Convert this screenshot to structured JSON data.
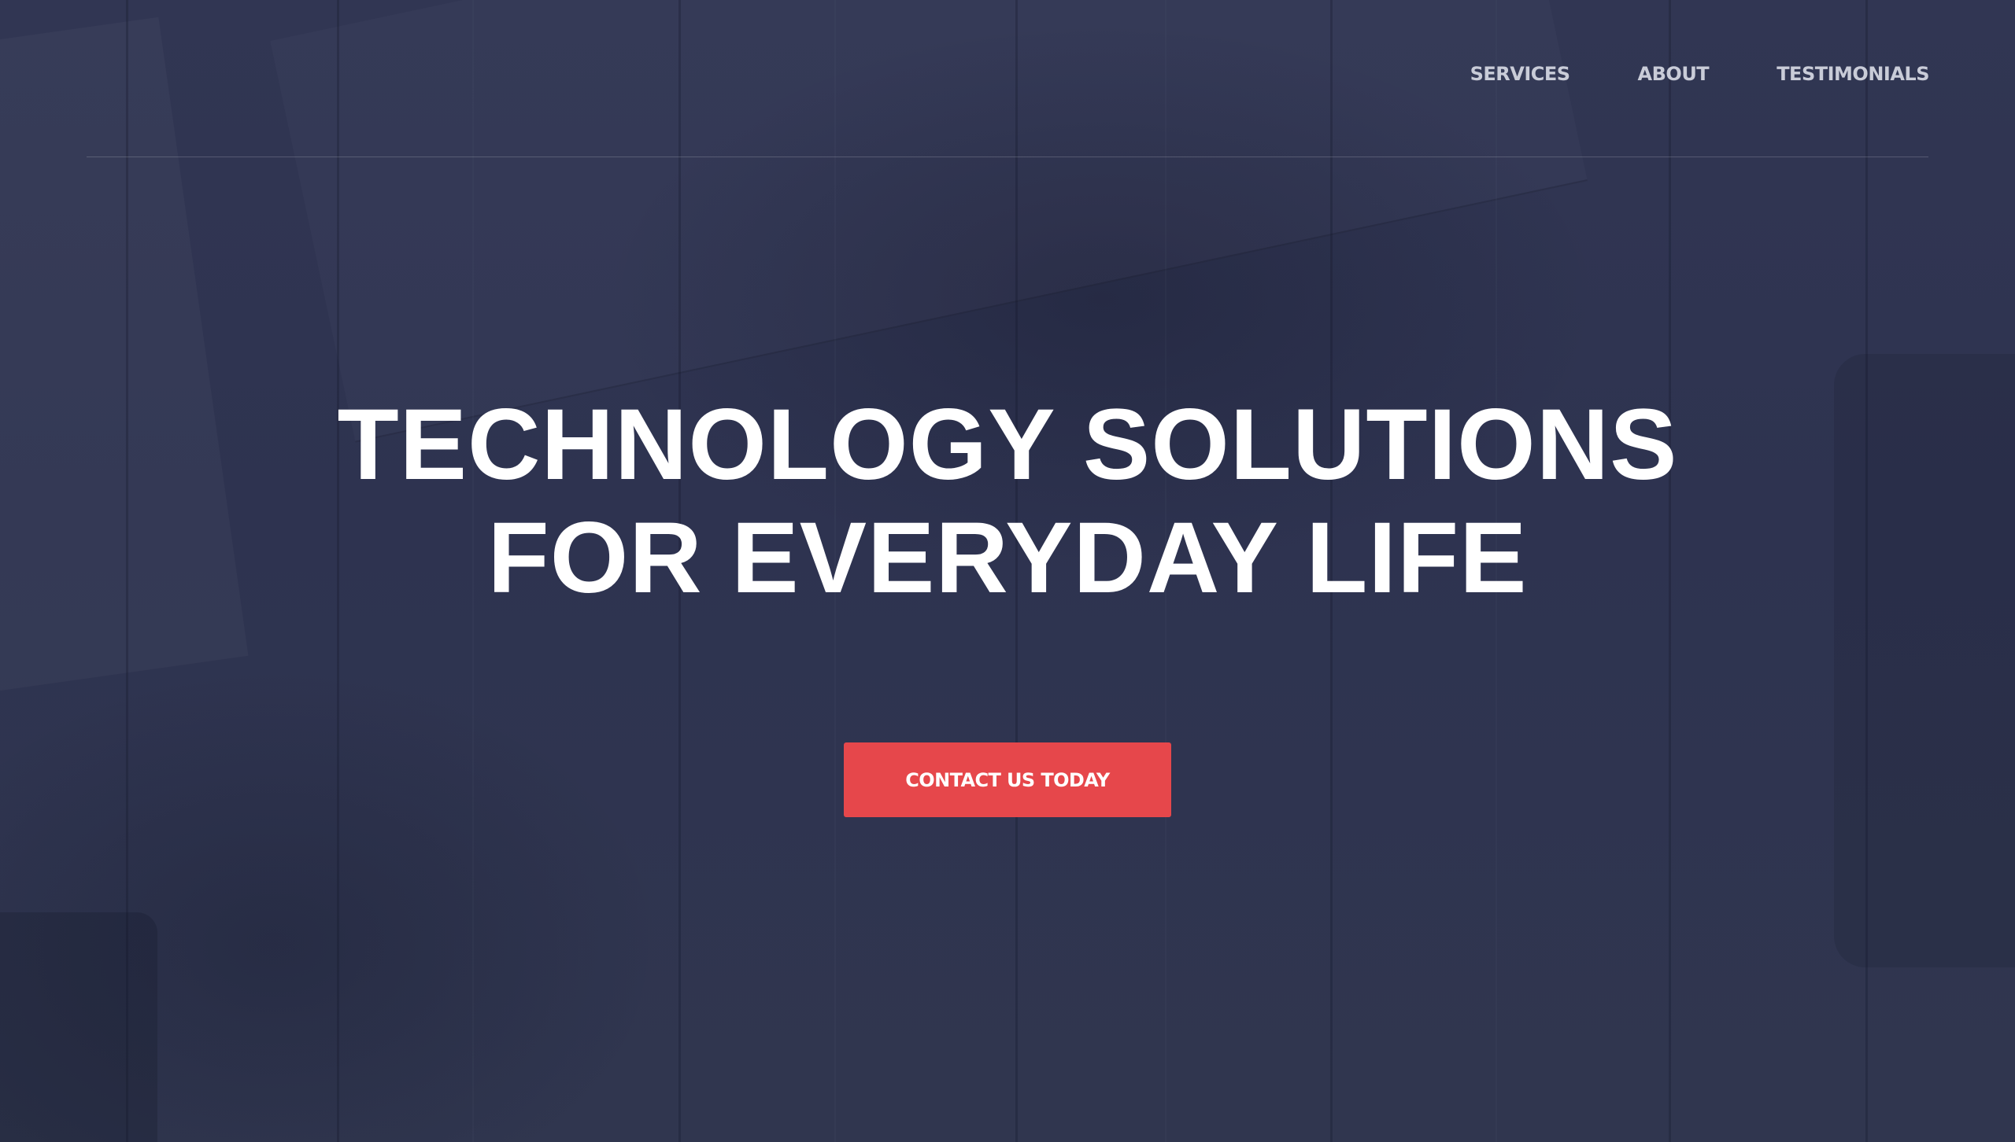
{
  "nav": {
    "items": [
      {
        "label": "SERVICES"
      },
      {
        "label": "ABOUT"
      },
      {
        "label": "TESTIMONIALS"
      }
    ]
  },
  "hero": {
    "title_line1": "TECHNOLOGY SOLUTIONS",
    "title_line2": "FOR EVERYDAY LIFE",
    "cta_label": "CONTACT US TODAY"
  },
  "colors": {
    "background": "#2f3450",
    "accent": "#e6474b",
    "text": "#ffffff",
    "nav_text": "#c9ccd8"
  }
}
